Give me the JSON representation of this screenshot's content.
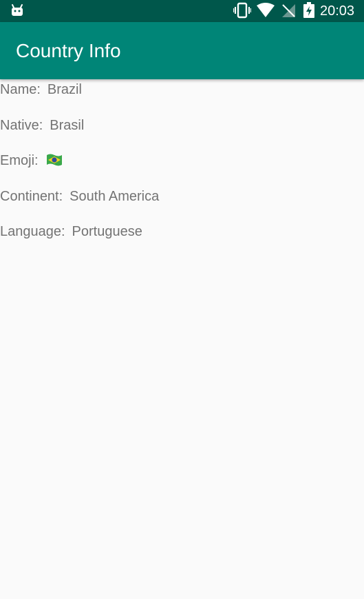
{
  "status_bar": {
    "time": "20:03",
    "icons": [
      "android-icon",
      "vibrate-icon",
      "wifi-icon",
      "no-signal-icon",
      "battery-charging-icon"
    ]
  },
  "app_bar": {
    "title": "Country Info"
  },
  "country": {
    "name_label": "Name:",
    "name_value": "Brazil",
    "native_label": "Native:",
    "native_value": "Brasil",
    "emoji_label": "Emoji:",
    "emoji_value": "🇧🇷",
    "continent_label": "Continent:",
    "continent_value": "South America",
    "language_label": "Language:",
    "language_value": "Portuguese"
  },
  "colors": {
    "status_bar": "#00574b",
    "app_bar": "#008577",
    "background": "#fafafa",
    "text": "#737373"
  }
}
